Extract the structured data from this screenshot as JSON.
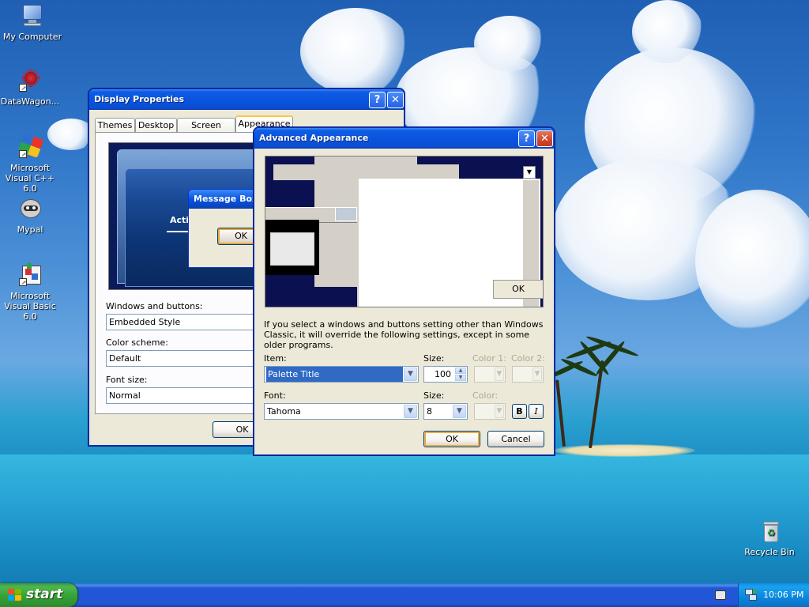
{
  "desktop": {
    "icons": [
      {
        "label": "My Computer"
      },
      {
        "label": "DataWagon..."
      },
      {
        "label": "Microsoft Visual C++ 6.0"
      },
      {
        "label": "Mypal"
      },
      {
        "label": "Microsoft Visual Basic 6.0"
      },
      {
        "label": "Recycle Bin"
      }
    ]
  },
  "display_properties": {
    "title": "Display Properties",
    "help_label": "?",
    "close_label": "✕",
    "tabs": [
      {
        "label": "Themes"
      },
      {
        "label": "Desktop"
      },
      {
        "label": "Screen Saver"
      },
      {
        "label": "Appearance"
      }
    ],
    "preview": {
      "message_box_title": "Message Box",
      "active_label": "Acti",
      "ok_label": "OK"
    },
    "windows_buttons_label": "Windows and buttons:",
    "windows_buttons_value": "Embedded Style",
    "color_scheme_label": "Color scheme:",
    "color_scheme_value": "Default",
    "font_size_label": "Font size:",
    "font_size_value": "Normal",
    "ok_label": "OK"
  },
  "advanced_appearance": {
    "title": "Advanced Appearance",
    "help_label": "?",
    "close_label": "✕",
    "preview_ok_label": "OK",
    "description": "If you select a windows and buttons setting other than Windows Classic, it will override the following settings, except in some older programs.",
    "item_label": "Item:",
    "item_value": "Palette Title",
    "size_label": "Size:",
    "size_value": "100",
    "color1_label": "Color 1:",
    "color2_label": "Color 2:",
    "font_label": "Font:",
    "font_value": "Tahoma",
    "font_size_label": "Size:",
    "font_size_value": "8",
    "font_color_label": "Color:",
    "bold_label": "B",
    "italic_label": "I",
    "ok_label": "OK",
    "cancel_label": "Cancel"
  },
  "taskbar": {
    "start_label": "start",
    "clock": "10:06 PM"
  },
  "colors": {
    "title_blue": "#0a54de",
    "close_red": "#d0462c",
    "start_green": "#37a437",
    "selection_blue": "#316ac5"
  }
}
